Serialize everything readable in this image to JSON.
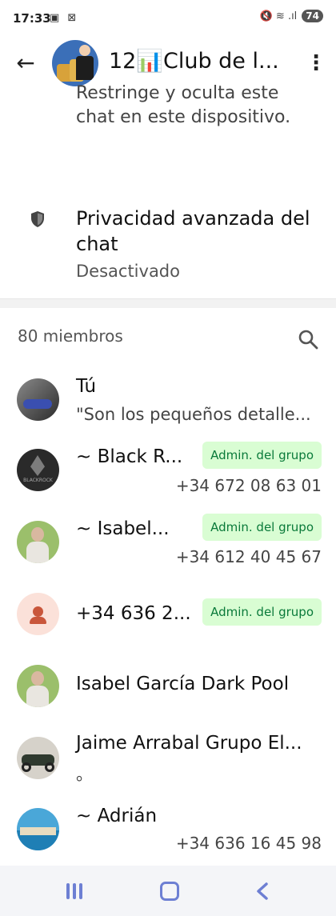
{
  "status_bar": {
    "time": "17:33",
    "notification_icons": "▣ ⊠",
    "system_icons": "🔇 ≋ .ıl",
    "battery": "74"
  },
  "header": {
    "title": "12📊Club de l...",
    "back_icon": "arrow-left",
    "menu_icon": "more-vert"
  },
  "settings": {
    "lock_description": "Restringe y oculta este chat en este dispositivo.",
    "privacy_title": "Privacidad avanzada del chat",
    "privacy_status": "Desactivado"
  },
  "members": {
    "count_label": "80 miembros",
    "admin_badge": "Admin. del grupo",
    "list": [
      {
        "name": "Tú",
        "subtitle": "\"Son los pequeños detalle...",
        "avatar": "motorcycle-photo"
      },
      {
        "name": "~ Black R...",
        "phone": "+34 672 08 63 01",
        "admin": true,
        "avatar": "blackrock-logo"
      },
      {
        "name": "~ Isabel...",
        "phone": "+34 612 40 45 67",
        "admin": true,
        "avatar": "woman-photo"
      },
      {
        "name": "+34 636 2...",
        "admin": true,
        "avatar": "default-person"
      },
      {
        "name": "Isabel García Dark Pool",
        "avatar": "woman-photo"
      },
      {
        "name": "Jaime Arrabal Grupo El...",
        "subtitle": "。",
        "avatar": "motorcycle-photo"
      },
      {
        "name": "~ Adrián",
        "phone": "+34 636 16 45 98",
        "avatar": "coast-photo"
      }
    ]
  },
  "colors": {
    "admin_badge_bg": "#d9fdd3",
    "admin_badge_text": "#0a7a3a",
    "nav_icons": "#6d7fd3"
  }
}
